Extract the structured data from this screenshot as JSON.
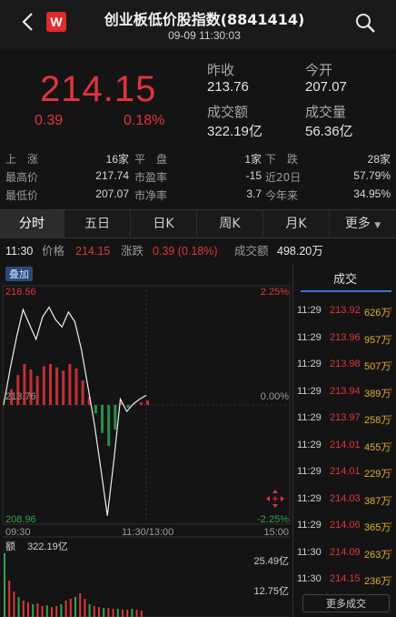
{
  "header": {
    "title": "创业板低价股指数(8841414)",
    "datetime": "09-09 11:30:03",
    "logo_letter": "W",
    "back_icon": "back-arrow-icon",
    "search_icon": "search-icon"
  },
  "quote": {
    "price": "214.15",
    "change": "0.39",
    "change_pct": "0.18%",
    "prev_close_label": "昨收",
    "prev_close": "213.76",
    "open_label": "今开",
    "open": "207.07",
    "amount_label": "成交额",
    "amount": "322.19亿",
    "volume_label": "成交量",
    "volume": "56.36亿"
  },
  "stats": {
    "row1": {
      "up_label": "上　涨",
      "up": "16家",
      "flat_label": "平　盘",
      "flat": "1家",
      "down_label": "下　跌",
      "down": "28家"
    },
    "row2": {
      "high_label": "最高价",
      "high": "217.74",
      "pe_label": "市盈率",
      "pe": "-15",
      "d20_label": "近20日",
      "d20": "57.79%"
    },
    "row3": {
      "low_label": "最低价",
      "low": "207.07",
      "pb_label": "市净率",
      "pb": "3.7",
      "ytd_label": "今年来",
      "ytd": "34.95%"
    }
  },
  "tabs": [
    "分时",
    "五日",
    "日K",
    "周K",
    "月K",
    "更多"
  ],
  "info": {
    "time": "11:30",
    "price_label": "价格",
    "price": "214.15",
    "change_label": "涨跌",
    "change": "0.39 (0.18%)",
    "amount_label": "成交额",
    "amount": "498.20万"
  },
  "chart": {
    "overlay_label": "叠加",
    "y_max": "218.56",
    "y_mid": "213.76",
    "y_min": "208.96",
    "pct_max": "2.25%",
    "pct_mid": "0.00%",
    "pct_min": "-2.25%",
    "t_start": "09:30",
    "t_mid": "11:30/13:00",
    "t_end": "15:00",
    "vol_label": "额",
    "vol_total": "322.19亿",
    "vol_max": "25.49亿",
    "vol_mid": "12.75亿",
    "colors": {
      "up": "#e0343c",
      "down": "#2ea44f",
      "line": "#f0f0f0"
    }
  },
  "chart_data": {
    "type": "line",
    "x": [
      "09:30",
      "11:30"
    ],
    "ylim": [
      208.96,
      218.56
    ],
    "series": [
      {
        "values": [
          213.76,
          215.2,
          216.5,
          217.6,
          217.0,
          216.4,
          217.3,
          217.7,
          217.2,
          216.9,
          217.5,
          217.1,
          216.0,
          214.5,
          213.0,
          211.2,
          209.3,
          211.5,
          214.0,
          213.5,
          213.8,
          214.0,
          214.15
        ]
      }
    ]
  },
  "trades": {
    "header": "成交",
    "rows": [
      {
        "time": "11:29",
        "price": "213.92",
        "vol": "626万"
      },
      {
        "time": "11:29",
        "price": "213.96",
        "vol": "957万"
      },
      {
        "time": "11:29",
        "price": "213.98",
        "vol": "507万"
      },
      {
        "time": "11:29",
        "price": "213.94",
        "vol": "389万"
      },
      {
        "time": "11:29",
        "price": "213.97",
        "vol": "258万"
      },
      {
        "time": "11:29",
        "price": "214.01",
        "vol": "455万"
      },
      {
        "time": "11:29",
        "price": "214.01",
        "vol": "229万"
      },
      {
        "time": "11:29",
        "price": "214.03",
        "vol": "387万"
      },
      {
        "time": "11:29",
        "price": "214.06",
        "vol": "365万"
      },
      {
        "time": "11:30",
        "price": "214.09",
        "vol": "263万"
      },
      {
        "time": "11:30",
        "price": "214.15",
        "vol": "236万"
      }
    ],
    "more_label": "更多成交"
  }
}
